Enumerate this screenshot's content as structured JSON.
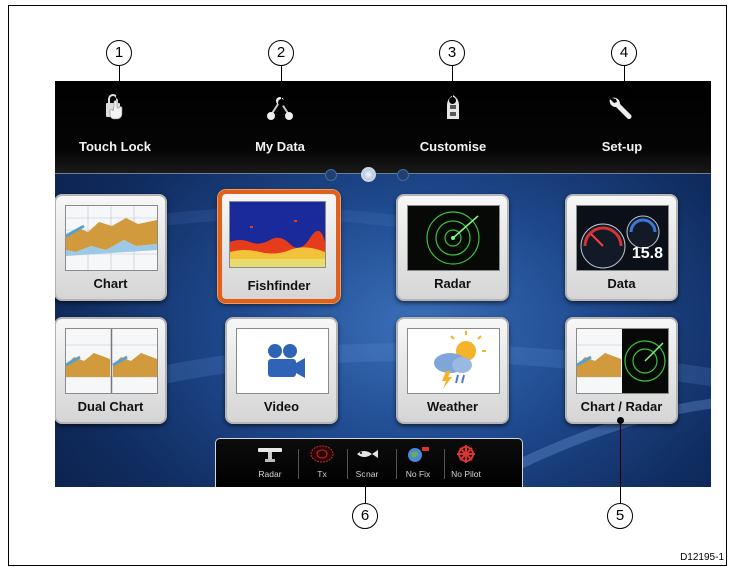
{
  "top_menu": [
    {
      "label": "Touch Lock",
      "icon": "touch-lock-icon"
    },
    {
      "label": "My Data",
      "icon": "my-data-icon"
    },
    {
      "label": "Customise",
      "icon": "customise-icon"
    },
    {
      "label": "Set-up",
      "icon": "set-up-icon"
    }
  ],
  "pager": {
    "page_count": 3,
    "active_page": 2
  },
  "apps": [
    {
      "label": "Chart",
      "icon": "chart-icon",
      "selected": false
    },
    {
      "label": "Fishfinder",
      "icon": "fishfinder-icon",
      "selected": true
    },
    {
      "label": "Radar",
      "icon": "radar-icon",
      "selected": false
    },
    {
      "label": "Data",
      "icon": "data-gauges-icon",
      "data_value": "15.8"
    },
    {
      "label": "Dual Chart",
      "icon": "dual-chart-icon",
      "selected": false
    },
    {
      "label": "Video",
      "icon": "video-camera-icon",
      "selected": false
    },
    {
      "label": "Weather",
      "icon": "weather-icon",
      "selected": false
    },
    {
      "label": "Chart / Radar",
      "icon": "chart-radar-icon",
      "selected": false
    }
  ],
  "status_bar": [
    {
      "label": "Radar",
      "icon": "radar-scanner-icon"
    },
    {
      "label": "Tx",
      "icon": "tx-icon"
    },
    {
      "label": "Sonar",
      "icon": "sonar-fish-icon"
    },
    {
      "label": "No Fix",
      "icon": "gps-no-fix-icon"
    },
    {
      "label": "No Pilot",
      "icon": "autopilot-icon"
    }
  ],
  "callouts": [
    "1",
    "2",
    "3",
    "4",
    "5",
    "6"
  ],
  "document_id": "D12195-1",
  "colors": {
    "selection_border": "#e0601c",
    "background_blue": "#1f4a8f",
    "topbar": "#000000",
    "tile": "#e8e8e8"
  }
}
